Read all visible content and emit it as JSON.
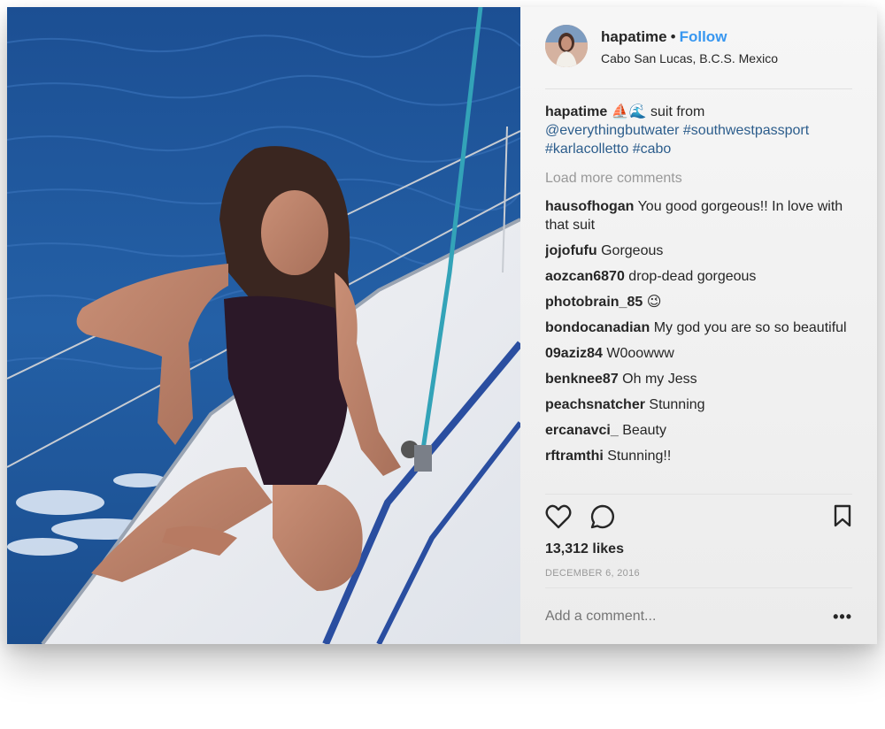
{
  "post": {
    "username": "hapatime",
    "separator": "•",
    "follow_label": "Follow",
    "location": "Cabo San Lucas, B.C.S. Mexico",
    "caption": {
      "username": "hapatime",
      "emoji": "⛵🌊",
      "text": "suit from",
      "tags": [
        "@everythingbutwater",
        "#southwestpassport",
        "#karlacolletto",
        "#cabo"
      ]
    },
    "load_more_label": "Load more comments",
    "comments": [
      {
        "user": "hausofhogan",
        "text": "You good gorgeous!! In love with that suit"
      },
      {
        "user": "jojofufu",
        "text": "Gorgeous"
      },
      {
        "user": "aozcan6870",
        "text": "drop-dead gorgeous"
      },
      {
        "user": "photobrain_85",
        "text": "😉"
      },
      {
        "user": "bondocanadian",
        "text": "My god you are so so beautiful"
      },
      {
        "user": "09aziz84",
        "text": "W0oowww"
      },
      {
        "user": "benknee87",
        "text": "Oh my Jess"
      },
      {
        "user": "peachsnatcher",
        "text": "Stunning"
      },
      {
        "user": "ercanavci_",
        "text": "Beauty"
      },
      {
        "user": "rftramthi",
        "text": "Stunning!!"
      }
    ],
    "likes": "13,312 likes",
    "date": "DECEMBER 6, 2016",
    "add_comment_placeholder": "Add a comment...",
    "more_label": "•••"
  },
  "icons": {
    "like": "heart-icon",
    "comment": "speech-bubble-icon",
    "save": "bookmark-icon",
    "more": "ellipsis-icon"
  },
  "colors": {
    "link": "#3897f0",
    "tag": "#2c5d8c",
    "muted": "#999999",
    "text": "#262626"
  }
}
